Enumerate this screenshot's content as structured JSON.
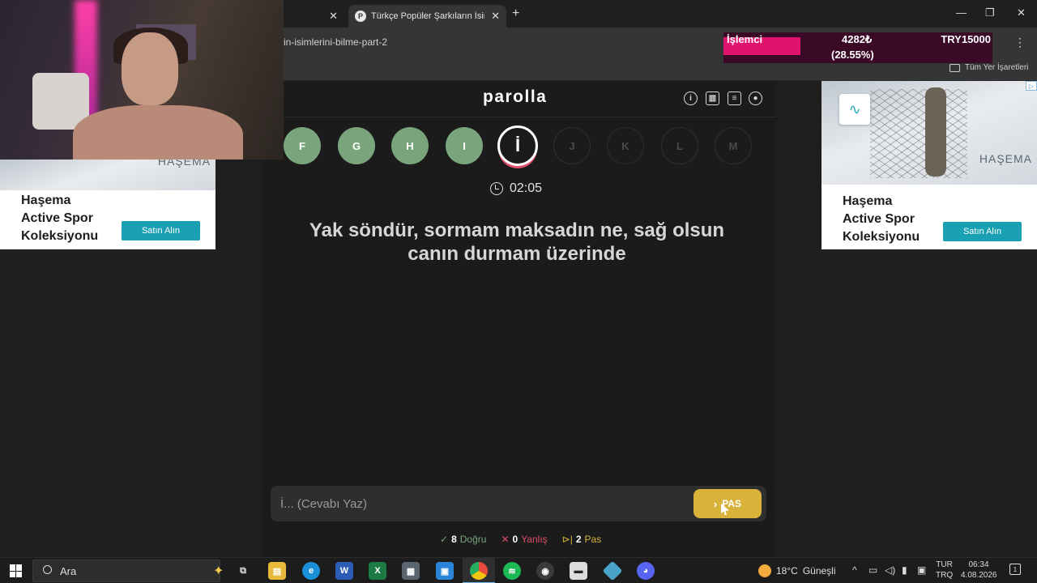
{
  "browser": {
    "tabs": [
      {
        "title": "",
        "active": false
      },
      {
        "title": "Türkçe Popüler Şarkıların İsimleri",
        "active": true,
        "favicon": "P"
      }
    ],
    "url": "in-isimlerini-bilme-part-2",
    "bookmarks_folder": "Tüm Yer İşaretleri"
  },
  "overlay": {
    "label": "İşlemci",
    "price": "4282₺",
    "percent": "(28.55%)",
    "total": "TRY15000",
    "progress_fraction": 0.2855,
    "accent": "#e0146e"
  },
  "game": {
    "brand": "parolla",
    "header_icons": [
      "info-icon",
      "stats-icon",
      "chat-icon",
      "user-icon"
    ],
    "letters": [
      {
        "letter": "F",
        "state": "done"
      },
      {
        "letter": "G",
        "state": "done"
      },
      {
        "letter": "H",
        "state": "done"
      },
      {
        "letter": "I",
        "state": "done"
      },
      {
        "letter": "İ",
        "state": "current"
      },
      {
        "letter": "J",
        "state": "todo"
      },
      {
        "letter": "K",
        "state": "todo"
      },
      {
        "letter": "L",
        "state": "todo"
      },
      {
        "letter": "M",
        "state": "todo"
      }
    ],
    "timer": "02:05",
    "question": "Yak söndür, sormam maksadın ne, sağ olsun canın durmam üzerinde",
    "answer_placeholder": "İ... (Cevabı Yaz)",
    "answer_value": "",
    "pass_label": "PAS",
    "stats": {
      "correct_count": "8",
      "correct_label": "Doğru",
      "wrong_count": "0",
      "wrong_label": "Yanlış",
      "pass_count": "2",
      "pass_label": "Pas"
    },
    "colors": {
      "done": "#7aa57c",
      "wrong": "#e0506b",
      "pass": "#d9b23b"
    }
  },
  "ads": {
    "left": {
      "headline": "Haşema Active Spor Koleksiyonu",
      "cta": "Satın Alın",
      "brandmark": "HAŞEMA"
    },
    "right": {
      "headline": "Haşema Active Spor Koleksiyonu",
      "cta": "Satın Alın",
      "brandmark": "HAŞEMA"
    }
  },
  "taskbar": {
    "search_placeholder": "Ara",
    "apps": [
      "task-view",
      "file-explorer",
      "edge",
      "word",
      "excel",
      "calculator",
      "store",
      "chrome",
      "spotify",
      "obs",
      "app",
      "app2",
      "discord"
    ],
    "weather": "18°C",
    "weather_desc": "Güneşli",
    "lang_top": "TUR",
    "lang_bottom": "TRQ",
    "time": "06:34",
    "date": "4.08.2026",
    "notifications": "1"
  }
}
